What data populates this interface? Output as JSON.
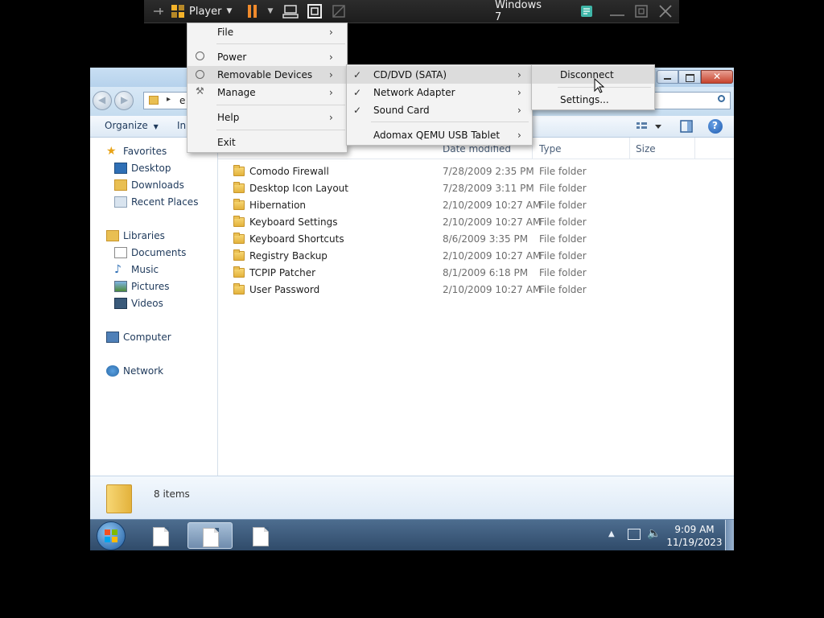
{
  "vm_toolbar": {
    "player_label": "Player",
    "vm_name": "Windows 7"
  },
  "player_menu": {
    "items": [
      {
        "label": "File"
      },
      {
        "label": "Power"
      },
      {
        "label": "Removable Devices"
      },
      {
        "label": "Manage"
      },
      {
        "label": "Help"
      },
      {
        "label": "Exit"
      }
    ]
  },
  "removable_menu": {
    "items": [
      {
        "label": "CD/DVD (SATA)",
        "checked": true
      },
      {
        "label": "Network Adapter",
        "checked": true
      },
      {
        "label": "Sound Card",
        "checked": true
      },
      {
        "label": "Adomax QEMU USB Tablet",
        "checked": false
      }
    ],
    "check_glyph": "✓",
    "arrow_glyph": "›"
  },
  "cd_menu": {
    "items": [
      {
        "label": "Disconnect"
      },
      {
        "label": "Settings..."
      }
    ]
  },
  "explorer": {
    "address_text": "e",
    "commands": {
      "organize": "Organize",
      "include": "In"
    },
    "nav": {
      "favorites": "Favorites",
      "desktop": "Desktop",
      "downloads": "Downloads",
      "recent": "Recent Places",
      "libraries": "Libraries",
      "documents": "Documents",
      "music": "Music",
      "pictures": "Pictures",
      "videos": "Videos",
      "computer": "Computer",
      "network": "Network"
    },
    "columns": {
      "date": "Date modified",
      "type": "Type",
      "size": "Size"
    },
    "files": [
      {
        "name": "Comodo Firewall",
        "date": "7/28/2009 2:35 PM",
        "type": "File folder"
      },
      {
        "name": "Desktop Icon Layout",
        "date": "7/28/2009 3:11 PM",
        "type": "File folder"
      },
      {
        "name": "Hibernation",
        "date": "2/10/2009 10:27 AM",
        "type": "File folder"
      },
      {
        "name": "Keyboard Settings",
        "date": "2/10/2009 10:27 AM",
        "type": "File folder"
      },
      {
        "name": "Keyboard Shortcuts",
        "date": "8/6/2009 3:35 PM",
        "type": "File folder"
      },
      {
        "name": "Registry Backup",
        "date": "2/10/2009 10:27 AM",
        "type": "File folder"
      },
      {
        "name": "TCPIP Patcher",
        "date": "8/1/2009 6:18 PM",
        "type": "File folder"
      },
      {
        "name": "User Password",
        "date": "2/10/2009 10:27 AM",
        "type": "File folder"
      }
    ],
    "details_text": "8 items"
  },
  "taskbar": {
    "time": "9:09 AM",
    "date": "11/19/2023"
  },
  "colors": {
    "menu_bg": "#f3f3f3",
    "menu_highlight": "#dcdcdc",
    "vm_bar": "#222222",
    "pause_orange": "#f08a2c",
    "note_green": "#3fb6a8"
  }
}
